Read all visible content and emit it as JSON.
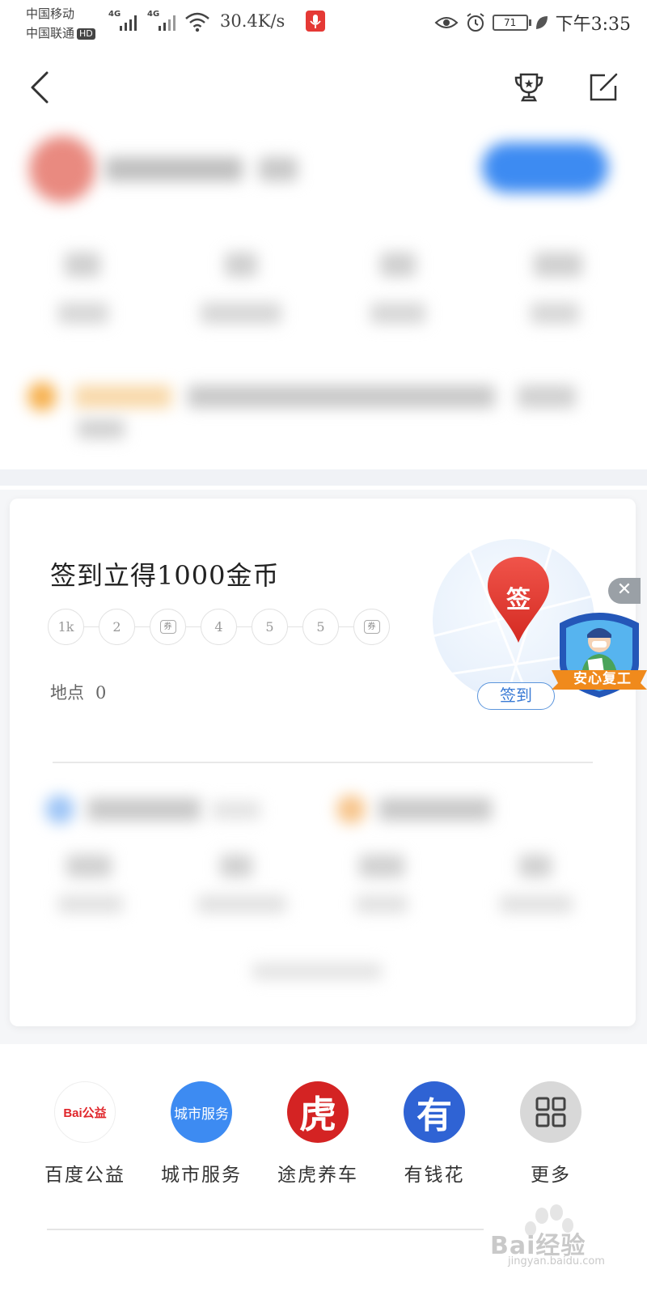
{
  "status_bar": {
    "carrier1": "中国移动",
    "carrier2": "中国联通",
    "hd_badge": "HD",
    "net1": "4G",
    "net2": "4G",
    "speed": "30.4K/s",
    "battery": "71",
    "time": "下午3:35"
  },
  "signin": {
    "title": "签到立得1000金币",
    "days": [
      "1k",
      "2",
      "券",
      "4",
      "5",
      "5",
      "券"
    ],
    "place_label": "地点",
    "place_value": "0",
    "pin_label": "签",
    "button_label": "签到",
    "badge_label": "安心复工"
  },
  "services": [
    {
      "label": "百度公益",
      "icon_text": "Bai公益",
      "icon": "baidu-charity-icon",
      "color": "#ffffff"
    },
    {
      "label": "城市服务",
      "icon_text": "城市服务",
      "icon": "city-service-icon",
      "color": "#3d8bf2"
    },
    {
      "label": "途虎养车",
      "icon_text": "虎",
      "icon": "tuhu-icon",
      "color": "#d42323"
    },
    {
      "label": "有钱花",
      "icon_text": "有",
      "icon": "youqianhua-icon",
      "color": "#2f63d4"
    },
    {
      "label": "更多",
      "icon_text": "",
      "icon": "grid-more-icon",
      "color": "#d8d8d8"
    }
  ],
  "watermark": {
    "main": "Bai经验",
    "sub": "jingyan.baidu.com"
  },
  "colors": {
    "accent_blue": "#3d8bf2",
    "pin_red": "#e8392f",
    "badge_blue": "#2457b8",
    "badge_orange": "#f08a1c"
  }
}
